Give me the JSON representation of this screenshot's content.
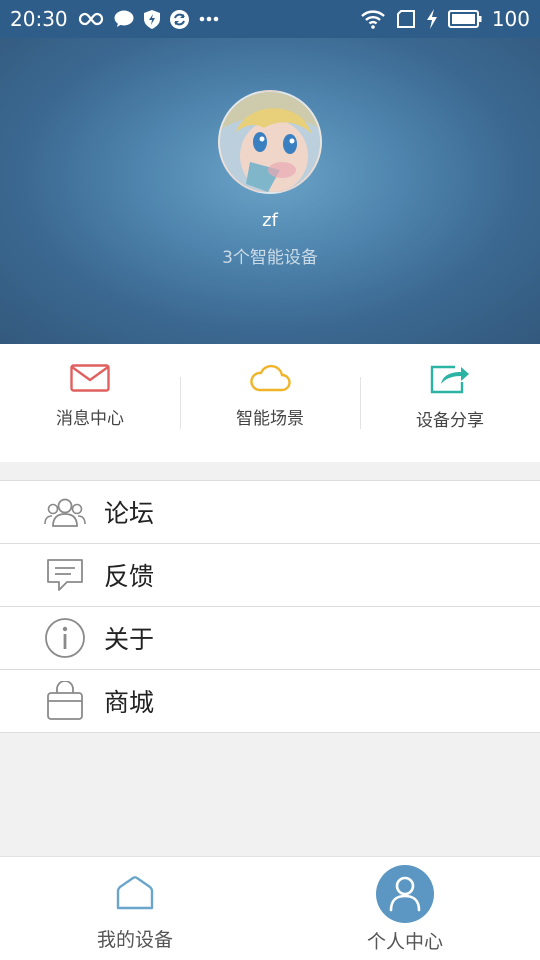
{
  "status_bar": {
    "time": "20:30",
    "battery": "100"
  },
  "profile": {
    "username": "zf",
    "device_count": "3个智能设备"
  },
  "quick_actions": [
    {
      "label": "消息中心",
      "icon": "mail-icon",
      "color": "#e0605f"
    },
    {
      "label": "智能场景",
      "icon": "cloud-icon",
      "color": "#f0b429"
    },
    {
      "label": "设备分享",
      "icon": "share-icon",
      "color": "#2bb3a3"
    }
  ],
  "menu": [
    {
      "label": "论坛",
      "icon": "users-icon"
    },
    {
      "label": "反馈",
      "icon": "chat-icon"
    },
    {
      "label": "关于",
      "icon": "info-icon"
    },
    {
      "label": "商城",
      "icon": "bag-icon"
    }
  ],
  "bottom_nav": [
    {
      "label": "我的设备",
      "icon": "home-icon"
    },
    {
      "label": "个人中心",
      "icon": "person-icon",
      "active": true
    }
  ],
  "colors": {
    "header": "#3f6e98",
    "accent": "#5b97c2"
  }
}
